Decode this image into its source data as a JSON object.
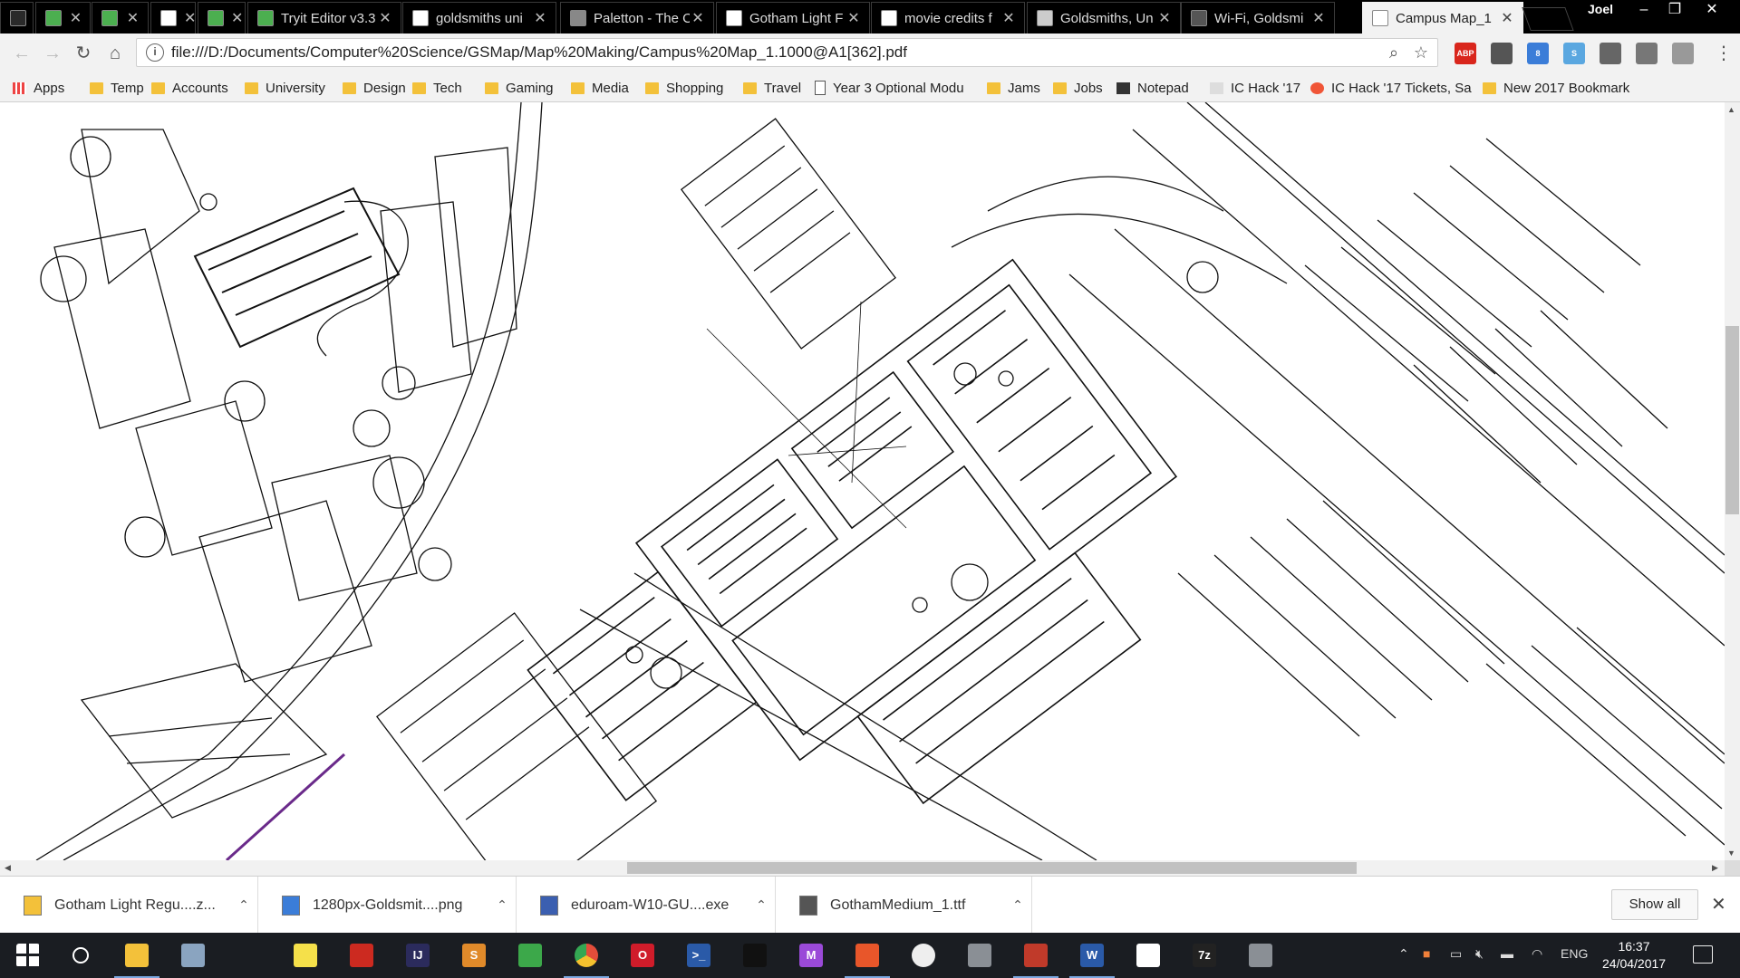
{
  "tabs": [
    {
      "title": "",
      "favicon": "mesh-icon",
      "color": "#2a2a2a"
    },
    {
      "title": "",
      "favicon": "sheet-icon",
      "color": "#4caf50"
    },
    {
      "title": "",
      "favicon": "sheet-icon",
      "color": "#4caf50"
    },
    {
      "title": "",
      "favicon": "pizza-icon",
      "color": "#ffffff"
    },
    {
      "title": "",
      "favicon": "sheet-icon",
      "color": "#4caf50"
    },
    {
      "title": "Tryit Editor v3.3",
      "favicon": "sheet-icon",
      "color": "#4caf50"
    },
    {
      "title": "goldsmiths uni",
      "favicon": "google-icon",
      "color": "#ffffff"
    },
    {
      "title": "Paletton - The C",
      "favicon": "paletton-icon",
      "color": "#888888"
    },
    {
      "title": "Gotham Light F",
      "favicon": "page-icon",
      "color": "#ffffff"
    },
    {
      "title": "movie credits f",
      "favicon": "google-icon",
      "color": "#ffffff"
    },
    {
      "title": "Goldsmiths, Un",
      "favicon": "wiki-table-icon",
      "color": "#cccccc"
    },
    {
      "title": "Wi-Fi, Goldsmi",
      "favicon": "google-g-icon",
      "color": "#555555"
    },
    {
      "title": "Campus Map_1",
      "favicon": "page-icon",
      "color": "#ffffff",
      "active": true
    }
  ],
  "profile_name": "Joel",
  "window_controls": {
    "minimize": "–",
    "restore": "❐",
    "close": "✕"
  },
  "toolbar": {
    "url": "file:///D:/Documents/Computer%20Science/GSMap/Map%20Making/Campus%20Map_1.1000@A1[362].pdf",
    "extensions": [
      {
        "name": "adblock-icon",
        "label": "ABP",
        "color": "#d9261c"
      },
      {
        "name": "puzzle-icon",
        "label": "",
        "color": "#555555"
      },
      {
        "name": "screenshot-icon",
        "label": "8",
        "color": "#3b7dd8"
      },
      {
        "name": "s-extension-icon",
        "label": "S",
        "color": "#5aa7e0"
      },
      {
        "name": "bookmark-ext-icon",
        "label": "",
        "color": "#666666"
      },
      {
        "name": "grid-ext-icon",
        "label": "",
        "color": "#777777"
      },
      {
        "name": "pdf-ext-icon",
        "label": "",
        "color": "#999999"
      }
    ]
  },
  "bookmarks": [
    {
      "label": "Apps",
      "icon": "apps-grid-icon"
    },
    {
      "label": "Temp",
      "icon": "folder-icon"
    },
    {
      "label": "Accounts",
      "icon": "folder-icon"
    },
    {
      "label": "University",
      "icon": "folder-icon"
    },
    {
      "label": "Design",
      "icon": "folder-icon"
    },
    {
      "label": "Tech",
      "icon": "folder-icon"
    },
    {
      "label": "Gaming",
      "icon": "folder-icon"
    },
    {
      "label": "Media",
      "icon": "folder-icon"
    },
    {
      "label": "Shopping",
      "icon": "folder-icon"
    },
    {
      "label": "Travel",
      "icon": "folder-icon"
    },
    {
      "label": "Year 3 Optional Modu",
      "icon": "page-icon"
    },
    {
      "label": "Jams",
      "icon": "folder-icon"
    },
    {
      "label": "Jobs",
      "icon": "folder-icon"
    },
    {
      "label": "Notepad",
      "icon": "s-notepad-icon"
    },
    {
      "label": "IC Hack '17",
      "icon": "ic-icon"
    },
    {
      "label": "IC Hack '17 Tickets, Sa",
      "icon": "eventbrite-icon"
    },
    {
      "label": "New 2017 Bookmark",
      "icon": "folder-icon"
    }
  ],
  "downloads": [
    {
      "name": "Gotham Light Regu....z...",
      "icon": "zip-icon",
      "color": "#f3c13a"
    },
    {
      "name": "1280px-Goldsmit....png",
      "icon": "image-file-icon",
      "color": "#3b7dd8"
    },
    {
      "name": "eduroam-W10-GU....exe",
      "icon": "installer-icon",
      "color": "#3b5fb0"
    },
    {
      "name": "GothamMedium_1.ttf",
      "icon": "font-file-icon",
      "color": "#555555"
    }
  ],
  "show_all_label": "Show all",
  "taskbar": {
    "apps": [
      {
        "name": "start-icon",
        "label": "",
        "color": "transparent"
      },
      {
        "name": "search-icon",
        "label": "",
        "color": "transparent"
      },
      {
        "name": "file-explorer-icon",
        "label": "",
        "color": "#f3c13a"
      },
      {
        "name": "pc-icon",
        "label": "",
        "color": "#8aa4c0"
      },
      {
        "name": "alien-icon",
        "label": "",
        "color": "transparent"
      },
      {
        "name": "sticky-notes-icon",
        "label": "",
        "color": "#f5e04a"
      },
      {
        "name": "acrobat-icon",
        "label": "",
        "color": "#cc2a20"
      },
      {
        "name": "intellij-icon",
        "label": "IJ",
        "color": "#2b2b5c"
      },
      {
        "name": "sublime-icon",
        "label": "S",
        "color": "#e08a2a"
      },
      {
        "name": "kaspersky-icon",
        "label": "",
        "color": "#3ca84a"
      },
      {
        "name": "chrome-icon",
        "label": "",
        "color": "#e44d3a"
      },
      {
        "name": "opera-icon",
        "label": "O",
        "color": "#d01c2a"
      },
      {
        "name": "powershell-icon",
        "label": ">_",
        "color": "#2a5aa8"
      },
      {
        "name": "cmd-icon",
        "label": "",
        "color": "#111111"
      },
      {
        "name": "maya-icon",
        "label": "M",
        "color": "#9a4ad8"
      },
      {
        "name": "git-icon",
        "label": "",
        "color": "#e8562a"
      },
      {
        "name": "github-icon",
        "label": "",
        "color": "#333333"
      },
      {
        "name": "camera-icon",
        "label": "",
        "color": "#8a8f95"
      },
      {
        "name": "snipping-icon",
        "label": "",
        "color": "#c03a2a"
      },
      {
        "name": "word-icon",
        "label": "W",
        "color": "#2a5aa8"
      },
      {
        "name": "photos-icon",
        "label": "",
        "color": "#ffffff"
      },
      {
        "name": "7zip-icon",
        "label": "7z",
        "color": "#222222"
      },
      {
        "name": "camera2-icon",
        "label": "",
        "color": "#8a8f95"
      }
    ],
    "tray": {
      "language": "ENG",
      "time": "16:37",
      "date": "24/04/2017"
    }
  }
}
